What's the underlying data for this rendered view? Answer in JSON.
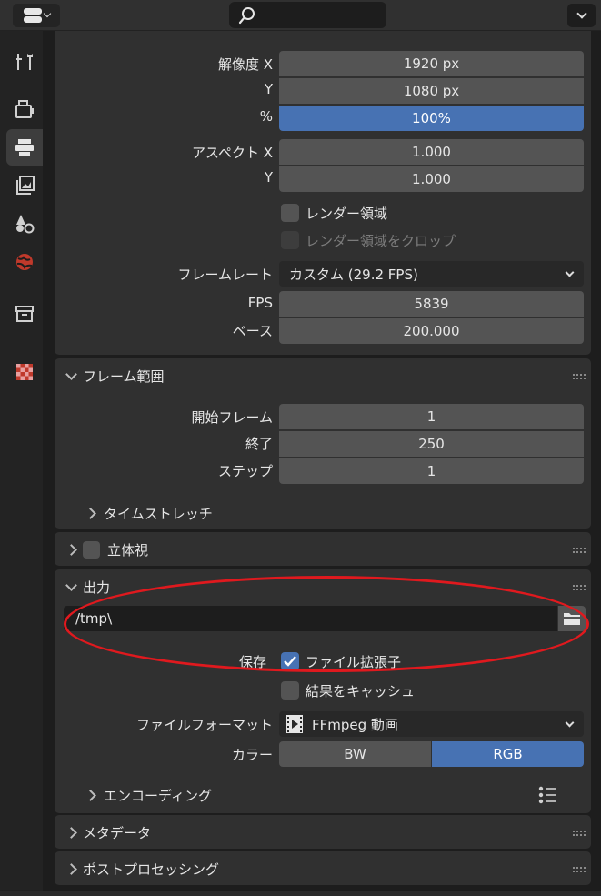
{
  "topbar": {
    "editor_icon": "properties-editor-icon",
    "search_icon": "search-icon",
    "menu_icon": "chevron-down-icon"
  },
  "sidebar": {
    "tabs": [
      {
        "icon": "tool-icon",
        "active": false
      },
      {
        "icon": "render-icon",
        "active": false
      },
      {
        "icon": "output-icon",
        "active": true
      },
      {
        "icon": "view-layer-icon",
        "active": false
      },
      {
        "icon": "scene-icon",
        "active": false
      },
      {
        "icon": "world-icon",
        "active": false
      },
      {
        "icon": "collection-icon",
        "active": false
      },
      {
        "icon": "texture-icon",
        "active": false
      }
    ]
  },
  "format": {
    "resolution_x_label": "解像度 X",
    "resolution_x_value": "1920 px",
    "resolution_y_label": "Y",
    "resolution_y_value": "1080 px",
    "percent_label": "%",
    "percent_value": "100%",
    "aspect_x_label": "アスペクト X",
    "aspect_x_value": "1.000",
    "aspect_y_label": "Y",
    "aspect_y_value": "1.000",
    "render_region_label": "レンダー領域",
    "crop_region_label": "レンダー領域をクロップ",
    "framerate_label": "フレームレート",
    "framerate_value": "カスタム (29.2 FPS)",
    "fps_label": "FPS",
    "fps_value": "5839",
    "base_label": "ベース",
    "base_value": "200.000"
  },
  "frame_range": {
    "title": "フレーム範囲",
    "start_label": "開始フレーム",
    "start_value": "1",
    "end_label": "終了",
    "end_value": "250",
    "step_label": "ステップ",
    "step_value": "1",
    "time_stretch_label": "タイムストレッチ"
  },
  "stereoscopy": {
    "title": "立体視"
  },
  "output": {
    "title": "出力",
    "path_value": "/tmp\\",
    "save_label": "保存",
    "file_extensions_label": "ファイル拡張子",
    "cache_result_label": "結果をキャッシュ",
    "file_format_label": "ファイルフォーマット",
    "file_format_value": "FFmpeg 動画",
    "color_label": "カラー",
    "color_options": [
      "BW",
      "RGB"
    ],
    "color_selected": "RGB",
    "encoding_label": "エンコーディング"
  },
  "metadata": {
    "title": "メタデータ"
  },
  "post_processing": {
    "title": "ポストプロセッシング"
  },
  "colors": {
    "accent": "#4772b3",
    "panel": "#303030",
    "field": "#545454",
    "annotation": "#e0191e"
  }
}
